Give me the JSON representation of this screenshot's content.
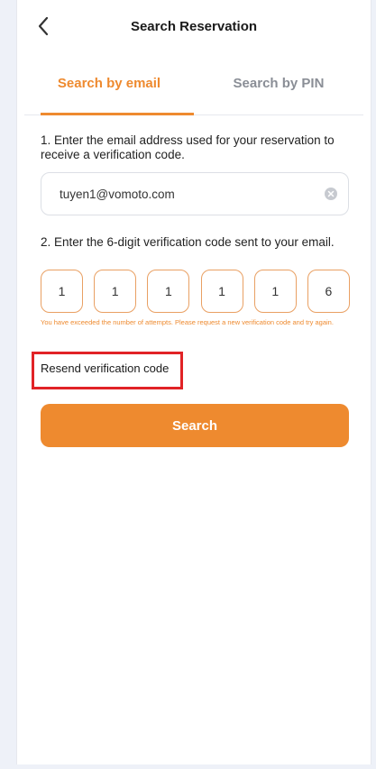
{
  "header": {
    "title": "Search Reservation"
  },
  "tabs": [
    {
      "label": "Search by email",
      "active": true
    },
    {
      "label": "Search by PIN",
      "active": false
    }
  ],
  "step1": {
    "instruction": "1. Enter the email address used for your reservation to receive a verification code.",
    "email_value": "tuyen1@vomoto.com"
  },
  "step2": {
    "instruction": "2. Enter the 6-digit verification code sent to your email.",
    "code_digits": [
      "1",
      "1",
      "1",
      "1",
      "1",
      "6"
    ],
    "error": "You have exceeded the number of attempts. Please request a new verification code and try again."
  },
  "resend_label": "Resend verification code",
  "search_label": "Search",
  "colors": {
    "accent": "#ee8a2f",
    "highlight_border": "#e12326"
  },
  "icons": {
    "back": "chevron-left-icon",
    "clear": "clear-circle-icon"
  }
}
